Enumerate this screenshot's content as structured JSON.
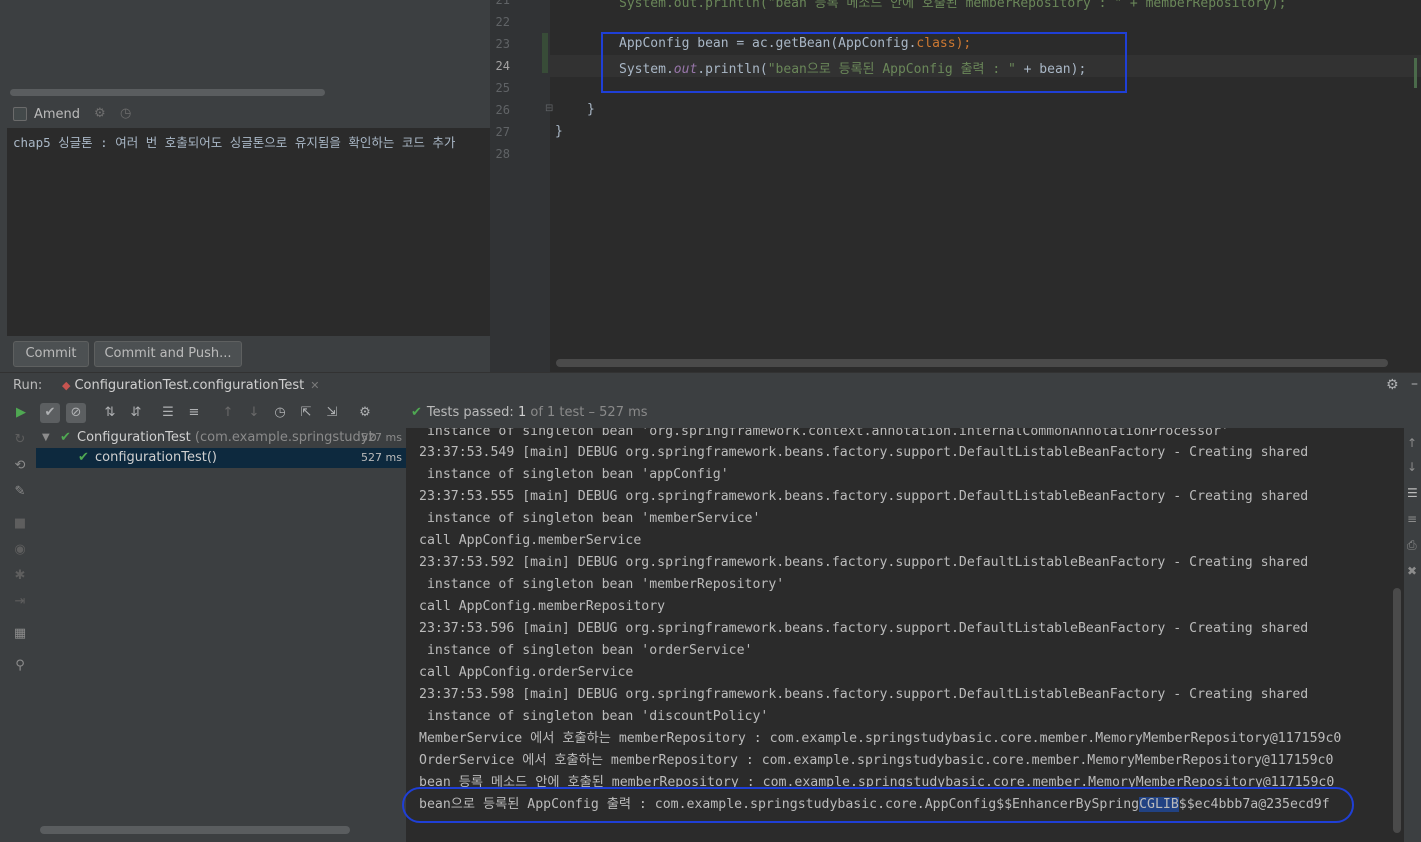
{
  "commit": {
    "amend_label": "Amend",
    "message": "chap5 싱글톤 : 여러 번 호출되어도 싱글톤으로 유지됨을 확인하는 코드 추가",
    "commit_label": "Commit",
    "commit_push_label": "Commit and Push..."
  },
  "editor": {
    "line_numbers": [
      "21",
      "22",
      "23",
      "24",
      "25",
      "26",
      "27",
      "28"
    ],
    "top_partial_line": "System.out.println(\"bean 등록 메소드 안에 호출된 memberRepository : \" + memberRepository);",
    "line23_plain_a": "AppConfig bean = ac.getBean(AppConfig.",
    "line23_kw": "class",
    "line23_plain_b": ");",
    "line24_a": "System.",
    "line24_out": "out",
    "line24_b": ".println(",
    "line24_str": "\"bean으로 등록된 AppConfig 출력 : \"",
    "line24_c": " + bean);",
    "line26": "}",
    "line27": "}"
  },
  "run": {
    "label": "Run:",
    "tab_title": "ConfigurationTest.configurationTest"
  },
  "status": {
    "prefix": "Tests passed: ",
    "passed_count": "1",
    "suffix": " of 1 test – 527 ms"
  },
  "tree": {
    "root_name": "ConfigurationTest",
    "root_pkg": " (com.example.springstudyb",
    "root_time": "527 ms",
    "child_name": "configurationTest()",
    "child_time": "527 ms"
  },
  "console": {
    "lines": [
      " instance of singleton bean 'org.springframework.context.annotation.internalCommonAnnotationProcessor'",
      "23:37:53.549 [main] DEBUG org.springframework.beans.factory.support.DefaultListableBeanFactory - Creating shared",
      " instance of singleton bean 'appConfig'",
      "23:37:53.555 [main] DEBUG org.springframework.beans.factory.support.DefaultListableBeanFactory - Creating shared",
      " instance of singleton bean 'memberService'",
      "call AppConfig.memberService",
      "23:37:53.592 [main] DEBUG org.springframework.beans.factory.support.DefaultListableBeanFactory - Creating shared",
      " instance of singleton bean 'memberRepository'",
      "call AppConfig.memberRepository",
      "23:37:53.596 [main] DEBUG org.springframework.beans.factory.support.DefaultListableBeanFactory - Creating shared",
      " instance of singleton bean 'orderService'",
      "call AppConfig.orderService",
      "23:37:53.598 [main] DEBUG org.springframework.beans.factory.support.DefaultListableBeanFactory - Creating shared",
      " instance of singleton bean 'discountPolicy'",
      "MemberService 에서 호출하는 memberRepository : com.example.springstudybasic.core.member.MemoryMemberRepository@117159c0",
      "OrderService 에서 호출하는 memberRepository : com.example.springstudybasic.core.member.MemoryMemberRepository@117159c0",
      "bean 등록 메소드 안에 호출된 memberRepository : com.example.springstudybasic.core.member.MemoryMemberRepository@117159c0"
    ],
    "last_a": "bean으로 등록된 AppConfig 출력 : com.example.springstudybasic.core.AppConfig$$EnhancerBySpring",
    "last_hl": "CGLIB",
    "last_b": "$$ec4bbb7a@235ecd9f"
  },
  "colors": {
    "accent_blue_annotation": "#1f3fd6",
    "pass_green": "#4fa852",
    "selection": "#0d293e"
  }
}
